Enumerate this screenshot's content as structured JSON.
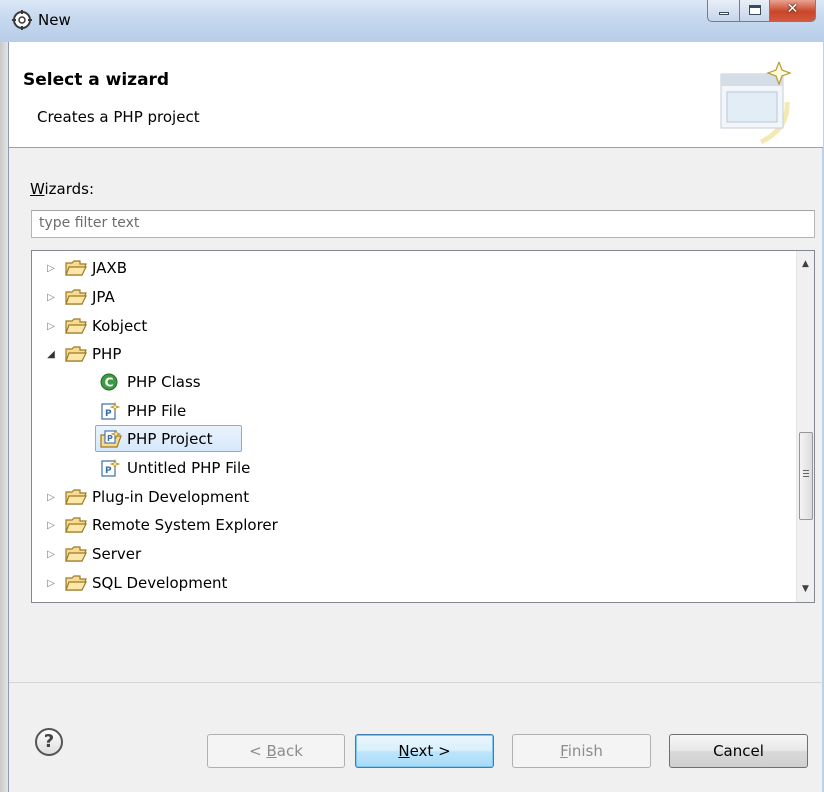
{
  "window": {
    "title": "New"
  },
  "header": {
    "title": "Select a wizard",
    "description": "Creates a PHP project"
  },
  "wizards": {
    "label_accel": "W",
    "label_rest": "izards:",
    "filter_placeholder": "type filter text"
  },
  "tree": [
    {
      "label": "JAXB",
      "icon": "folder-icon",
      "expanded": false,
      "level": 0
    },
    {
      "label": "JPA",
      "icon": "folder-icon",
      "expanded": false,
      "level": 0
    },
    {
      "label": "Kobject",
      "icon": "folder-icon",
      "expanded": false,
      "level": 0
    },
    {
      "label": "PHP",
      "icon": "folder-open-icon",
      "expanded": true,
      "level": 0
    },
    {
      "label": "PHP Class",
      "icon": "php-class-icon",
      "level": 1
    },
    {
      "label": "PHP File",
      "icon": "php-file-icon",
      "level": 1
    },
    {
      "label": "PHP Project",
      "icon": "php-project-icon",
      "level": 1,
      "selected": true
    },
    {
      "label": "Untitled PHP File",
      "icon": "php-file-icon",
      "level": 1
    },
    {
      "label": "Plug-in Development",
      "icon": "folder-icon",
      "expanded": false,
      "level": 0
    },
    {
      "label": "Remote System Explorer",
      "icon": "folder-icon",
      "expanded": false,
      "level": 0
    },
    {
      "label": "Server",
      "icon": "folder-icon",
      "expanded": false,
      "level": 0
    },
    {
      "label": "SQL Development",
      "icon": "folder-icon",
      "expanded": false,
      "level": 0
    }
  ],
  "buttons": {
    "back": {
      "prefix": "< ",
      "accel": "B",
      "rest": "ack"
    },
    "next": {
      "accel": "N",
      "rest": "ext >"
    },
    "finish": {
      "accel": "F",
      "rest": "inish"
    },
    "cancel": "Cancel"
  },
  "colors": {
    "selection": "#d6e8fb",
    "default_button": "#bee6fd",
    "folder": "#e8c46a"
  }
}
